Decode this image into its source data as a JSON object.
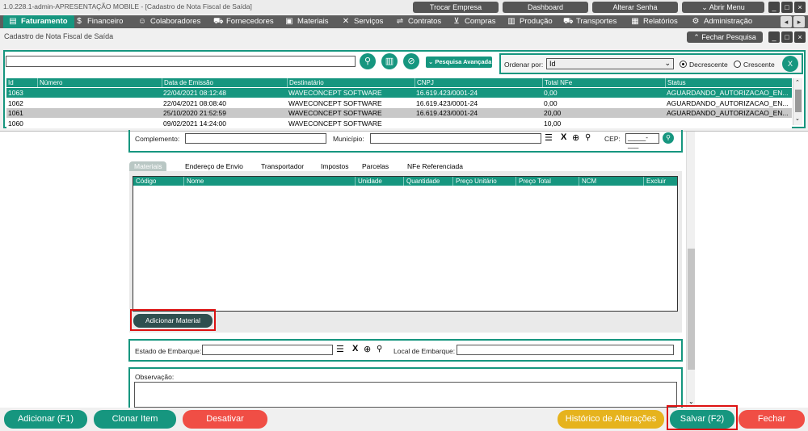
{
  "window": {
    "title": "1.0.228.1-admin-APRESENTAÇÃO MOBILE - [Cadastro de Nota Fiscal de Saída]",
    "top_buttons": [
      "Trocar Empresa",
      "Dashboard",
      "Alterar Senha",
      "Abrir Menu"
    ],
    "controls": [
      "_",
      "□",
      "×"
    ]
  },
  "menu": {
    "items": [
      {
        "label": "Faturamento",
        "icon": "document-icon"
      },
      {
        "label": "Financeiro",
        "icon": "money-icon"
      },
      {
        "label": "Colaboradores",
        "icon": "people-icon"
      },
      {
        "label": "Fornecedores",
        "icon": "truck-icon"
      },
      {
        "label": "Materiais",
        "icon": "box-icon"
      },
      {
        "label": "Serviços",
        "icon": "tools-icon"
      },
      {
        "label": "Contratos",
        "icon": "handshake-icon"
      },
      {
        "label": "Compras",
        "icon": "cart-icon"
      },
      {
        "label": "Produção",
        "icon": "factory-icon"
      },
      {
        "label": "Transportes",
        "icon": "delivery-icon"
      },
      {
        "label": "Relatórios",
        "icon": "report-icon"
      },
      {
        "label": "Administração",
        "icon": "gear-icon"
      }
    ],
    "arrows": [
      "◂",
      "▸"
    ]
  },
  "subheader": {
    "label": "Cadastro de Nota Fiscal de Saída",
    "close_search": "Fechar Pesquisa"
  },
  "search": {
    "value": "",
    "advanced": "Pesquisa Avançada",
    "order_label": "Ordenar por:",
    "order_value": "Id",
    "desc_label": "Decrescente",
    "asc_label": "Crescente",
    "sort": "Decrescente"
  },
  "grid": {
    "columns": [
      "Id",
      "Número",
      "Data de Emissão",
      "Destinatário",
      "CNPJ",
      "Total NFe",
      "Status"
    ],
    "rows": [
      {
        "id": "1063",
        "numero": "",
        "data": "22/04/2021 08:12:48",
        "dest": "WAVECONCEPT SOFTWARE",
        "cnpj": "16.619.423/0001-24",
        "total": "0,00",
        "status": "AGUARDANDO_AUTORIZACAO_EN..."
      },
      {
        "id": "1062",
        "numero": "",
        "data": "22/04/2021 08:08:40",
        "dest": "WAVECONCEPT SOFTWARE",
        "cnpj": "16.619.423/0001-24",
        "total": "0,00",
        "status": "AGUARDANDO_AUTORIZACAO_EN..."
      },
      {
        "id": "1061",
        "numero": "",
        "data": "25/10/2020 21:52:59",
        "dest": "WAVECONCEPT SOFTWARE",
        "cnpj": "16.619.423/0001-24",
        "total": "20,00",
        "status": "AGUARDANDO_AUTORIZACAO_EN..."
      },
      {
        "id": "1060",
        "numero": "",
        "data": "09/02/2021 14:24:00",
        "dest": "WAVECONCEPT SOFTWARE",
        "cnpj": "",
        "total": "10,00",
        "status": ""
      }
    ],
    "selected_index": 0,
    "highlight_index": 2
  },
  "address": {
    "complemento_label": "Complemento:",
    "municipio_label": "Município:",
    "cep_label": "CEP:",
    "cep_value": "_____-___"
  },
  "tabs": [
    "Materiais",
    "Endereço de Envio",
    "Transportador",
    "Impostos",
    "Parcelas",
    "NFe Referenciada"
  ],
  "materials": {
    "columns": [
      "Código",
      "Nome",
      "Unidade",
      "Quantidade",
      "Preço Unitário",
      "Preço Total",
      "NCM",
      "Excluir"
    ],
    "add_button": "Adicionar Material"
  },
  "shipping": {
    "estado_label": "Estado de Embarque:",
    "local_label": "Local de Embarque:"
  },
  "obs": {
    "label": "Observação:"
  },
  "footer": {
    "add": "Adicionar (F1)",
    "clone": "Clonar Item",
    "deactivate": "Desativar",
    "history": "Histórico de Alterações",
    "save": "Salvar (F2)",
    "close": "Fechar"
  },
  "colors": {
    "teal": "#16967f",
    "red": "#f04e45",
    "yellow": "#e6b31d",
    "dark": "#555555"
  }
}
